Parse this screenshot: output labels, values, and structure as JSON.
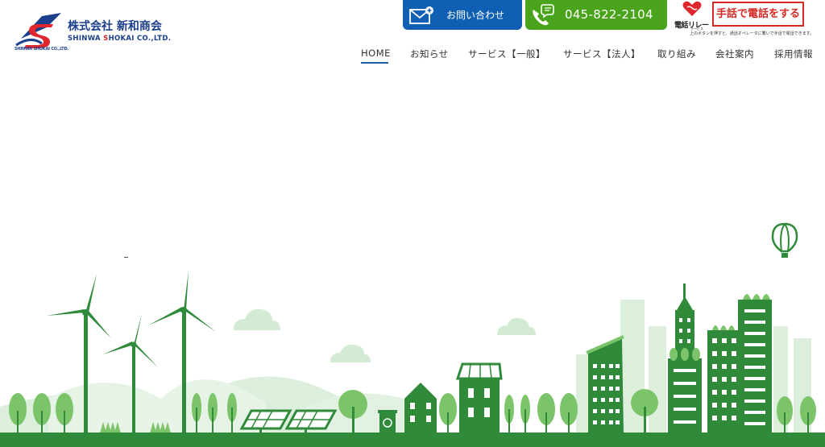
{
  "company": {
    "name_jp": "株式会社 新和商会",
    "name_en_prefix": "SHINWA ",
    "name_en_highlight": "S",
    "name_en_suffix": "HOKAI CO.,LTD.",
    "mark_caption": "SHINWA SHOKAI CO.,LTD."
  },
  "header": {
    "contact_label": "お問い合わせ",
    "phone_label": "045-822-2104",
    "relay_logo_text": "電話リレー",
    "relay_logo_sub": "サービス",
    "sign_button_label": "手話で電話をする",
    "sign_note": "上のボタンを押すと、通話オペレータに繋いで手話で電話できます。"
  },
  "nav": {
    "items": [
      {
        "label": "HOME",
        "active": true
      },
      {
        "label": "お知らせ"
      },
      {
        "label": "サービス【一般】"
      },
      {
        "label": "サービス【法人】"
      },
      {
        "label": "取り組み"
      },
      {
        "label": "会社案内"
      },
      {
        "label": "採用情報"
      }
    ]
  },
  "colors": {
    "brand_blue": "#1b3f8c",
    "contact_blue": "#0f5fb2",
    "phone_green": "#49a41b",
    "sign_red": "#d52a24",
    "scene_green": "#2f8a3a",
    "scene_light": "#d9ecd9"
  },
  "icons": {
    "contact": "mail-icon",
    "phone": "phone-chat-icon",
    "relay": "heart-hands-icon",
    "balloon": "hot-air-balloon-icon"
  }
}
